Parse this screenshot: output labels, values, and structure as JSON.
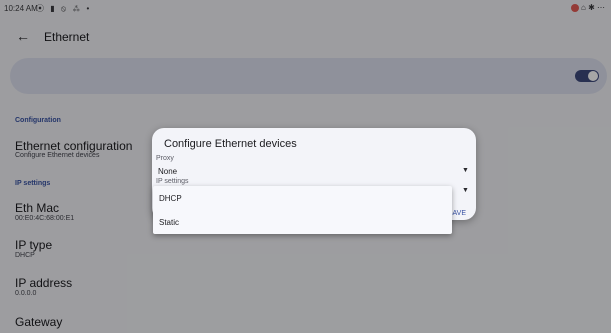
{
  "status": {
    "time": "10:24 AM",
    "left_icons": "⦿ ▮ ⦸ ⁂ •",
    "right_icons": "⌂ ✱ ⋯"
  },
  "appbar": {
    "title": "Ethernet"
  },
  "sections": {
    "configuration": "Configuration",
    "ethernet_configuration": "Ethernet configuration",
    "ethernet_configuration_sub": "Configure Ethernet devices",
    "ip_settings": "IP settings",
    "eth_mac": "Eth Mac",
    "eth_mac_value": "00:E0:4C:68:00:E1",
    "ip_type": "IP type",
    "ip_type_value": "DHCP",
    "ip_address": "IP address",
    "ip_address_value": "0.0.0.0",
    "gateway": "Gateway"
  },
  "dialog": {
    "title": "Configure Ethernet devices",
    "proxy_label": "Proxy",
    "proxy_value": "None",
    "ip_settings_label": "IP settings",
    "save": "SAVE"
  },
  "menu": {
    "options": [
      "DHCP",
      "Static"
    ]
  },
  "colors": {
    "accent": "#3953a4",
    "switch": "#3e4a7d"
  }
}
